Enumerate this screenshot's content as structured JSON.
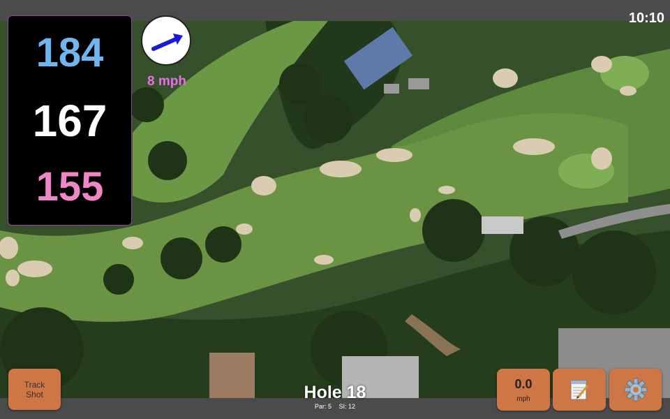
{
  "status": {
    "time": "10:10"
  },
  "yardage": {
    "back": "184",
    "middle": "167",
    "front": "155",
    "colors": {
      "back": "#6eb5f2",
      "middle": "#ffffff",
      "front": "#ef86c7",
      "border": "#a23ca8"
    }
  },
  "wind": {
    "speed": "8 mph",
    "icon": "wind-arrow-icon",
    "color": "#1a1ad6",
    "label_color": "#e86de6"
  },
  "hole": {
    "title": "Hole 18",
    "par": "Par: 5",
    "si": "SI: 12"
  },
  "buttons": {
    "track_shot": {
      "line1": "Track",
      "line2": "Shot"
    },
    "speed": {
      "value": "0.0",
      "unit": "mph"
    },
    "notes": {
      "icon": "notepad-icon"
    },
    "settings": {
      "icon": "gear-icon"
    },
    "color": "#cf7646"
  }
}
